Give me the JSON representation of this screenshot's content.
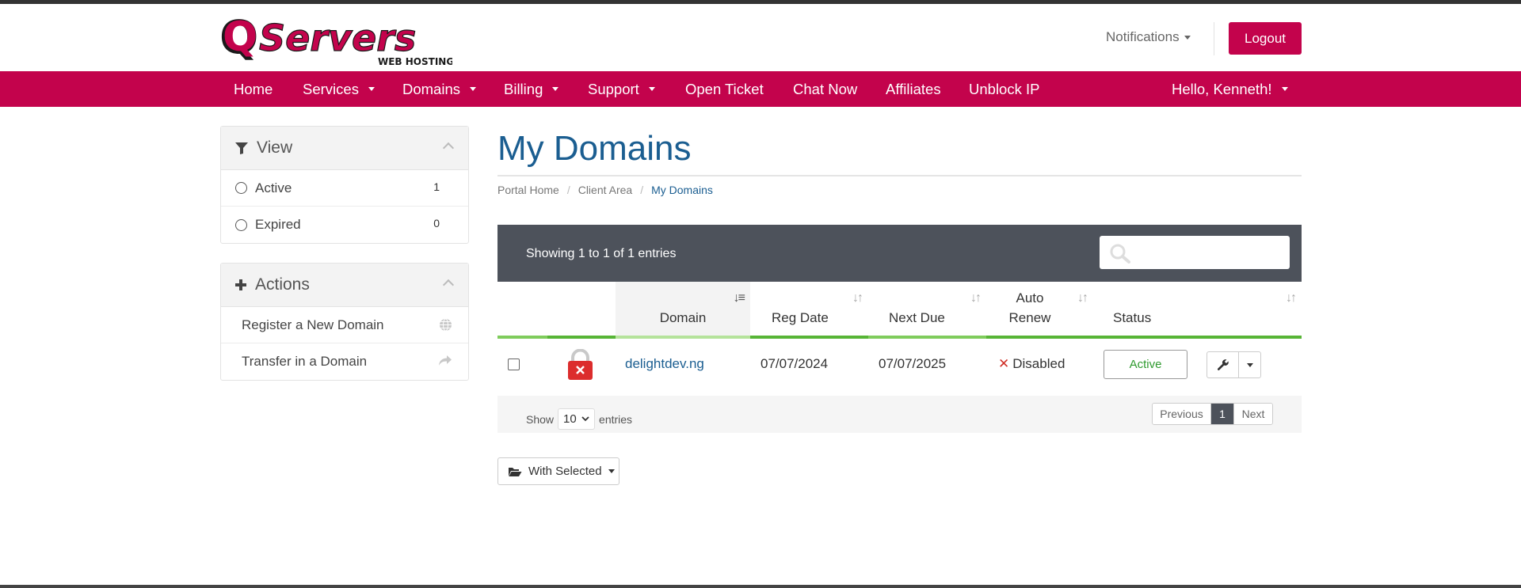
{
  "brand": {
    "logo_text": "QServers",
    "logo_sub": "WEB HOSTING",
    "accent_color": "#c3034c"
  },
  "header": {
    "notifications_label": "Notifications",
    "logout_label": "Logout"
  },
  "nav": {
    "items": [
      {
        "label": "Home"
      },
      {
        "label": "Services"
      },
      {
        "label": "Domains"
      },
      {
        "label": "Billing"
      },
      {
        "label": "Support"
      },
      {
        "label": "Open Ticket"
      },
      {
        "label": "Chat Now"
      },
      {
        "label": "Affiliates"
      },
      {
        "label": "Unblock IP"
      }
    ],
    "user_greeting": "Hello, Kenneth!"
  },
  "sidebar": {
    "view": {
      "title": "View",
      "filters": [
        {
          "label": "Active",
          "count": "1"
        },
        {
          "label": "Expired",
          "count": "0"
        }
      ]
    },
    "actions": {
      "title": "Actions",
      "items": [
        {
          "label": "Register a New Domain",
          "icon": "globe-icon"
        },
        {
          "label": "Transfer in a Domain",
          "icon": "share-arrow-icon"
        }
      ]
    }
  },
  "main": {
    "title": "My Domains",
    "breadcrumb": [
      "Portal Home",
      "Client Area",
      "My Domains"
    ],
    "table": {
      "info": "Showing 1 to 1 of 1 entries",
      "search_placeholder": "",
      "columns": [
        "Domain",
        "Reg Date",
        "Next Due",
        "Auto Renew",
        "Status"
      ],
      "rows": [
        {
          "domain": "delightdev.ng",
          "reg_date": "07/07/2024",
          "next_due": "07/07/2025",
          "auto_renew": "Disabled",
          "status": "Active"
        }
      ],
      "footer": {
        "show_label": "Show",
        "page_size": "10",
        "entries_label": "entries",
        "prev_label": "Previous",
        "current_page": "1",
        "next_label": "Next"
      }
    },
    "with_selected_label": "With Selected"
  }
}
